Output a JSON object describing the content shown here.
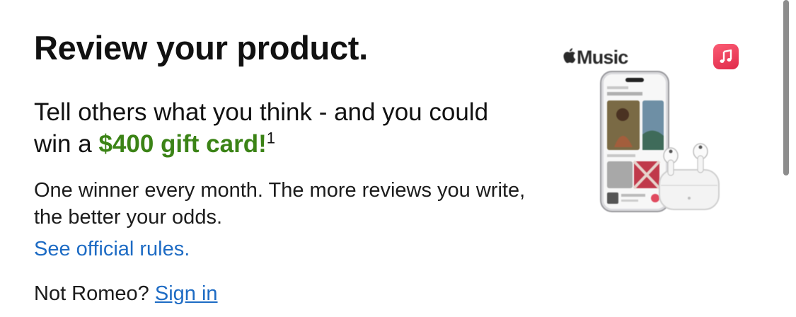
{
  "heading": "Review your product.",
  "promo": {
    "text_before": "Tell others what you think - and you could win a ",
    "highlight": "$400 gift card!",
    "footnote": "1"
  },
  "details": "One winner every month. The more reviews you write, the better your odds.",
  "rules_link": "See official rules.",
  "signin": {
    "prompt": "Not Romeo? ",
    "link": "Sign in"
  },
  "product_image": {
    "brand_text": "Music",
    "icons": [
      "apple-logo-icon",
      "music-app-icon",
      "iphone-icon",
      "airpods-pro-icon"
    ]
  },
  "colors": {
    "highlight_green": "#3b8316",
    "link_blue": "#1d6bc4",
    "music_red": "#fa3c5a"
  }
}
